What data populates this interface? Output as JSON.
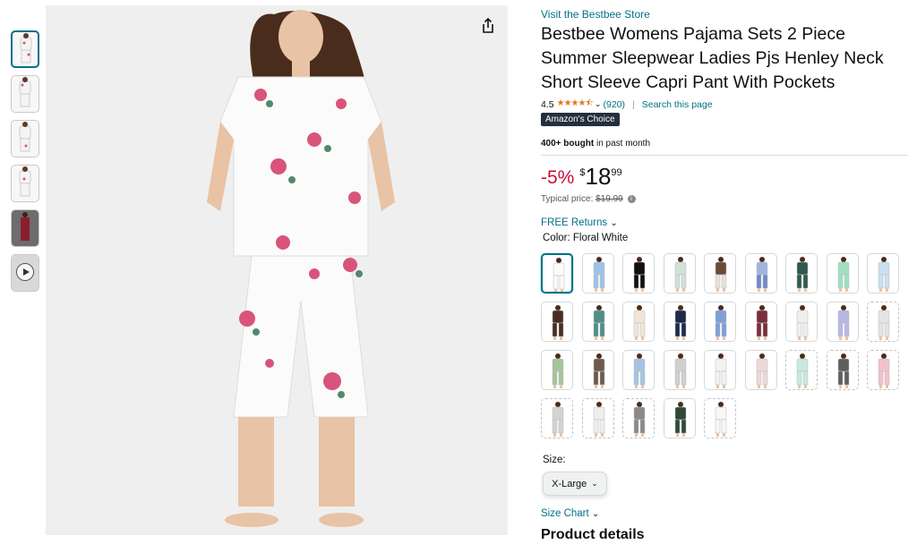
{
  "thumbnails": [
    {
      "label": "Front view white floral",
      "selected": true
    },
    {
      "label": "Side view",
      "selected": false
    },
    {
      "label": "Back view",
      "selected": false
    },
    {
      "label": "Detail view",
      "selected": false
    },
    {
      "label": "Lifestyle red",
      "selected": false
    },
    {
      "label": "Video",
      "selected": false
    }
  ],
  "store_link": "Visit the Bestbee Store",
  "title": "Bestbee Womens Pajama Sets 2 Piece Summer Sleepwear Ladies Pjs Henley Neck Short Sleeve Capri Pant With Pockets",
  "rating": {
    "value": "4.5",
    "stars": "★★★★⯪",
    "count": "(920)",
    "search_link": "Search this page"
  },
  "badge": {
    "prefix": "Amazon's",
    "suffix": " Choice"
  },
  "bought": {
    "bold": "400+ bought",
    "rest": " in past month"
  },
  "price": {
    "discount": "-5%",
    "currency": "$",
    "whole": "18",
    "fraction": "99"
  },
  "typical_price": {
    "label": "Typical price: ",
    "value": "$19.99",
    "info": "i"
  },
  "returns": "FREE Returns",
  "color": {
    "label": "Color: ",
    "value": "Floral White"
  },
  "size": {
    "label": "Size:",
    "value": "X-Large"
  },
  "size_chart": "Size Chart",
  "product_details": "Product details",
  "colors": {
    "accent": "#007185",
    "discount": "#cc0c39",
    "star": "#de7921",
    "badge_bg": "#232f3e"
  }
}
